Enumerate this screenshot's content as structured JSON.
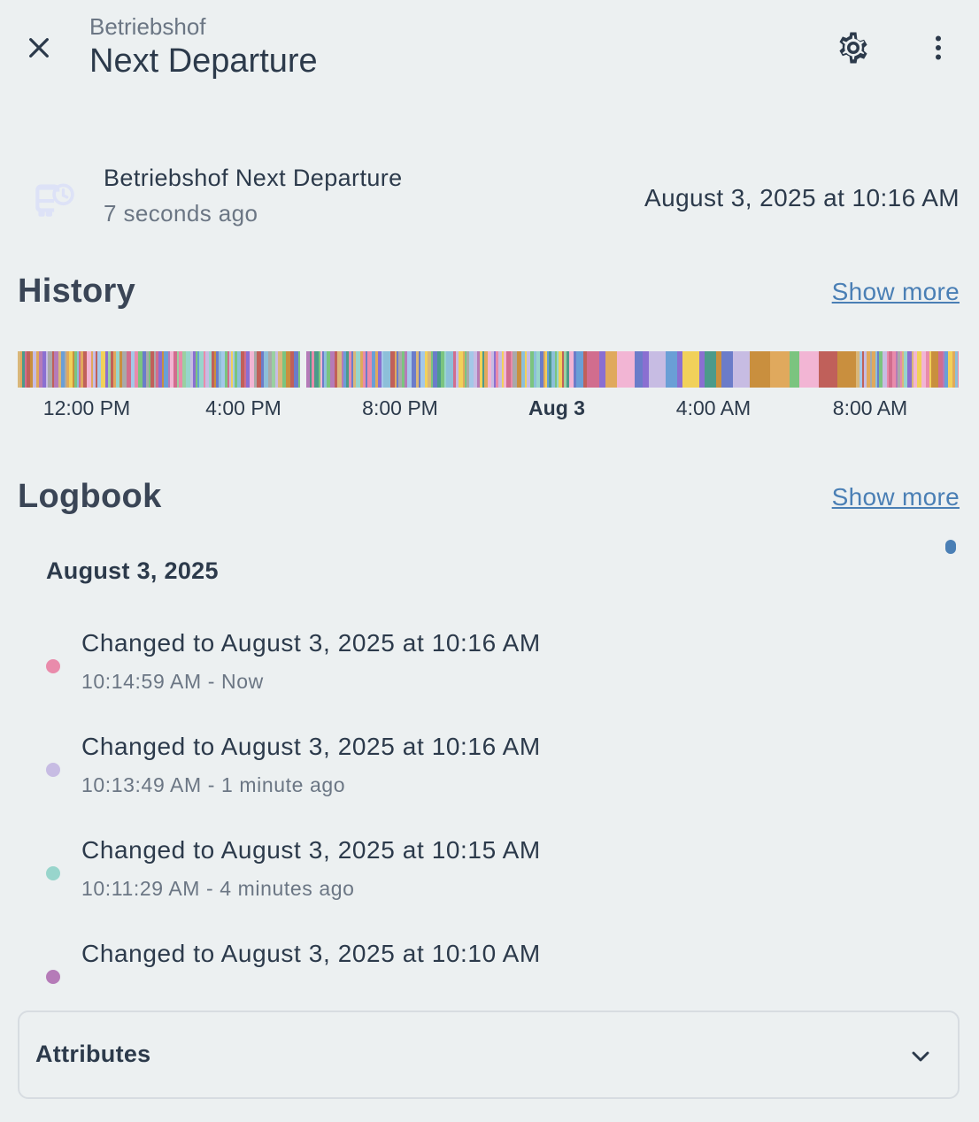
{
  "header": {
    "subtitle": "Betriebshof",
    "title": "Next Departure"
  },
  "entity": {
    "name": "Betriebshof Next Departure",
    "last_changed": "7 seconds ago",
    "state": "August 3, 2025 at 10:16 AM",
    "icon": "bus-clock-icon"
  },
  "history": {
    "title": "History",
    "show_more": "Show more",
    "axis_labels": [
      "12:00 PM",
      "4:00 PM",
      "8:00 PM",
      "Aug 3",
      "4:00 AM",
      "8:00 AM"
    ]
  },
  "logbook": {
    "title": "Logbook",
    "show_more": "Show more",
    "date": "August 3, 2025",
    "entries": [
      {
        "text": "Changed to August 3, 2025 at 10:16 AM",
        "time": "10:14:59 AM - Now",
        "color": "#e98bab"
      },
      {
        "text": "Changed to August 3, 2025 at 10:16 AM",
        "time": "10:13:49 AM - 1 minute ago",
        "color": "#c7bce3"
      },
      {
        "text": "Changed to August 3, 2025 at 10:15 AM",
        "time": "10:11:29 AM - 4 minutes ago",
        "color": "#98d5cc"
      },
      {
        "text": "Changed to August 3, 2025 at 10:10 AM",
        "time": "",
        "color": "#b57bb8"
      }
    ]
  },
  "attributes": {
    "label": "Attributes"
  },
  "colors": {
    "background": "#ecf0f1",
    "link": "#4a7fb5",
    "text": "#2c3a4b"
  }
}
